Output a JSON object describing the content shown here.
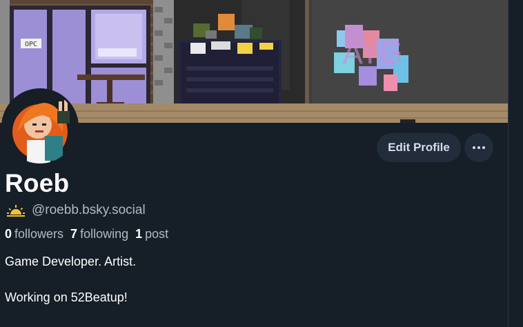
{
  "profile": {
    "display_name": "Roeb",
    "handle": "@roebb.bsky.social",
    "stats": {
      "followers_count": "0",
      "followers_label": "followers",
      "following_count": "7",
      "following_label": "following",
      "posts_count": "1",
      "posts_label": "post"
    },
    "bio_line1": "Game Developer. Artist.",
    "bio_line2": "Working on 52Beatup!"
  },
  "actions": {
    "edit_profile": "Edit Profile",
    "more_icon": "ellipsis-icon"
  },
  "icons": {
    "handle_icon": "sun-icon"
  },
  "banner": {
    "sign_text": "OPC",
    "graffiti_text": "AYG"
  },
  "colors": {
    "background": "#161e27",
    "button_bg": "#212d3b",
    "muted_text": "#aebbc9",
    "sun": "#f4c430"
  }
}
